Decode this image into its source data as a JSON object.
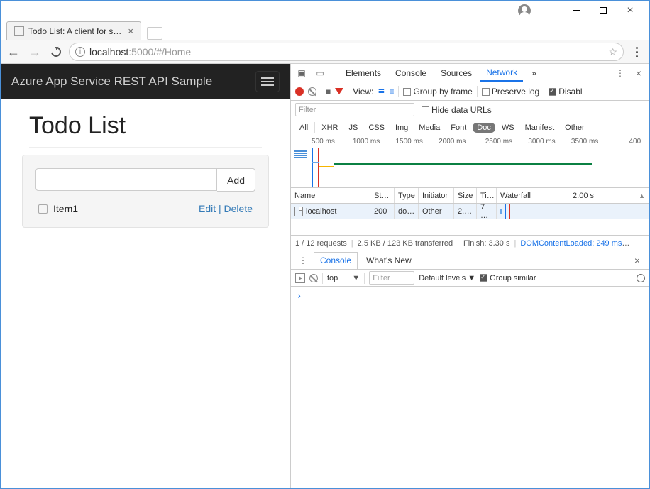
{
  "window": {
    "tab_title": "Todo List: A client for sam"
  },
  "browser": {
    "url_host": "localhost",
    "url_port": ":5000",
    "url_path": "/#/Home"
  },
  "app": {
    "brand": "Azure App Service REST API Sample",
    "page_title": "Todo List",
    "add_button": "Add",
    "item1_label": "Item1",
    "edit_label": "Edit",
    "delete_label": "Delete",
    "sep": " | "
  },
  "devtools": {
    "tabs": {
      "elements": "Elements",
      "console": "Console",
      "sources": "Sources",
      "network": "Network",
      "more": "»"
    },
    "toolbar": {
      "view_label": "View:",
      "group_by_frame": "Group by frame",
      "preserve_log": "Preserve log",
      "disable": "Disabl"
    },
    "filter_placeholder": "Filter",
    "hide_data_urls": "Hide data URLs",
    "types": {
      "all": "All",
      "xhr": "XHR",
      "js": "JS",
      "css": "CSS",
      "img": "Img",
      "media": "Media",
      "font": "Font",
      "doc": "Doc",
      "ws": "WS",
      "manifest": "Manifest",
      "other": "Other"
    },
    "ticks": {
      "t500": "500 ms",
      "t1000": "1000 ms",
      "t1500": "1500 ms",
      "t2000": "2000 ms",
      "t2500": "2500 ms",
      "t3000": "3000 ms",
      "t3500": "3500 ms",
      "t4000": "400"
    },
    "grid": {
      "headers": {
        "name": "Name",
        "status": "St…",
        "type": "Type",
        "initiator": "Initiator",
        "size": "Size",
        "time": "Ti…",
        "waterfall": "Waterfall",
        "wf_time": "2.00 s"
      },
      "row1": {
        "name": "localhost",
        "status": "200",
        "type": "do…",
        "initiator": "Other",
        "size": "2.…",
        "time": "7 …"
      }
    },
    "status": {
      "requests": "1 / 12 requests",
      "transferred": "2.5 KB / 123 KB transferred",
      "finish": "Finish: 3.30 s",
      "dcl": "DOMContentLoaded: 249 ms"
    },
    "drawer": {
      "console": "Console",
      "whatsnew": "What's New"
    },
    "console": {
      "context": "top",
      "filter_placeholder": "Filter",
      "levels": "Default levels ▼",
      "group_similar": "Group similar",
      "prompt": "›"
    }
  }
}
